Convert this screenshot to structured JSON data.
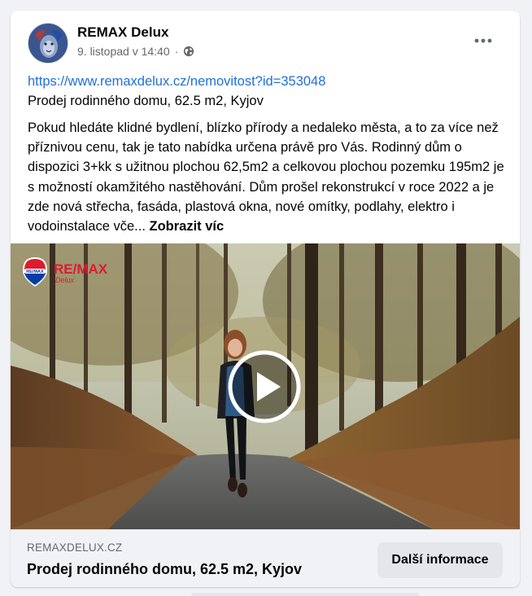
{
  "post": {
    "author": "REMAX Delux",
    "timestamp": "9. listopad v 14:40",
    "separator": "·",
    "privacy_icon": "globe-icon",
    "menu_icon": "more-horizontal-icon",
    "link_url": "https://www.remaxdelux.cz/nemovitost?id=353048",
    "subtitle": "Prodej rodinného domu, 62.5 m2, Kyjov",
    "description": "Pokud hledáte klidné bydlení, blízko přírody a nedaleko města, a to za více než příznivou cenu, tak je tato nabídka určena právě pro Vás. Rodinný dům o dispozici 3+kk s užitnou plochou 62,5m2 a celkovou plochou pozemku 195m2 je s možností okamžitého nastěhování. Dům prošel rekonstrukcí v roce 2022 a je zde nová střecha, fasáda, plastová okna, nové omítky, podlahy, elektro i vodoinstalace vče... ",
    "see_more": "Zobrazit víc"
  },
  "video": {
    "logo_text": "RE/MAX",
    "logo_sub": "Delux",
    "play_icon": "play-icon"
  },
  "link_preview": {
    "domain": "REMAXDELUX.CZ",
    "title": "Prodej rodinného domu, 62.5 m2, Kyjov",
    "button_label": "Další informace"
  },
  "colors": {
    "link": "#216fdb",
    "secondary_text": "#65676b",
    "button_bg": "#e4e6eb",
    "remax_red": "#dc1c2e",
    "remax_blue": "#003da5"
  }
}
